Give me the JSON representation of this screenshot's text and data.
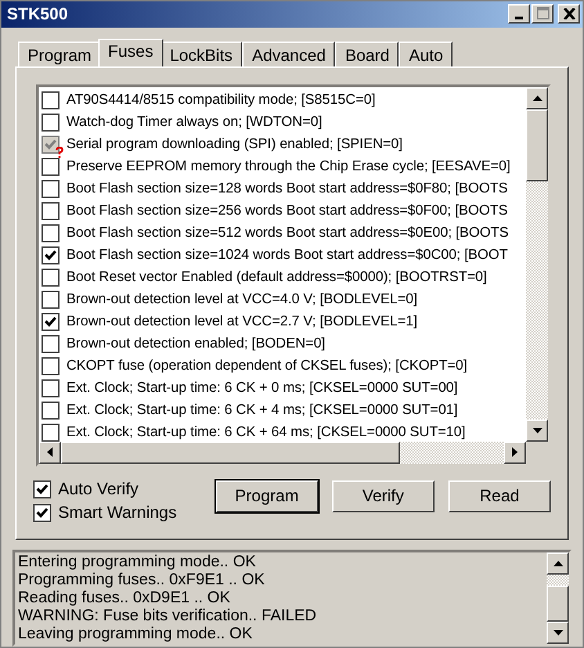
{
  "window": {
    "title": "STK500"
  },
  "tabs": [
    {
      "label": "Program",
      "selected": false
    },
    {
      "label": "Fuses",
      "selected": true
    },
    {
      "label": "LockBits",
      "selected": false
    },
    {
      "label": "Advanced",
      "selected": false
    },
    {
      "label": "Board",
      "selected": false
    },
    {
      "label": "Auto",
      "selected": false
    }
  ],
  "fuses": [
    {
      "label": "AT90S4414/8515 compatibility mode; [S8515C=0]",
      "checked": false,
      "disabled": false
    },
    {
      "label": "Watch-dog Timer always on; [WDTON=0]",
      "checked": false,
      "disabled": false
    },
    {
      "label": "Serial program downloading (SPI) enabled; [SPIEN=0]",
      "checked": true,
      "disabled": true
    },
    {
      "label": "Preserve EEPROM memory through the Chip Erase cycle; [EESAVE=0]",
      "checked": false,
      "disabled": false
    },
    {
      "label": "Boot Flash section size=128 words Boot start address=$0F80; [BOOTS",
      "checked": false,
      "disabled": false
    },
    {
      "label": "Boot Flash section size=256 words Boot start address=$0F00; [BOOTS",
      "checked": false,
      "disabled": false
    },
    {
      "label": "Boot Flash section size=512 words Boot start address=$0E00; [BOOTS",
      "checked": false,
      "disabled": false
    },
    {
      "label": "Boot Flash section size=1024 words Boot start address=$0C00; [BOOT",
      "checked": true,
      "disabled": false
    },
    {
      "label": "Boot Reset vector Enabled (default address=$0000); [BOOTRST=0]",
      "checked": false,
      "disabled": false
    },
    {
      "label": "Brown-out detection level at VCC=4.0 V; [BODLEVEL=0]",
      "checked": false,
      "disabled": false
    },
    {
      "label": "Brown-out detection level at VCC=2.7 V; [BODLEVEL=1]",
      "checked": true,
      "disabled": false
    },
    {
      "label": "Brown-out detection enabled; [BODEN=0]",
      "checked": false,
      "disabled": false
    },
    {
      "label": "CKOPT fuse (operation dependent of CKSEL fuses); [CKOPT=0]",
      "checked": false,
      "disabled": false
    },
    {
      "label": "Ext. Clock; Start-up time: 6 CK + 0 ms; [CKSEL=0000 SUT=00]",
      "checked": false,
      "disabled": false
    },
    {
      "label": "Ext. Clock; Start-up time: 6 CK + 4 ms; [CKSEL=0000 SUT=01]",
      "checked": false,
      "disabled": false
    },
    {
      "label": "Ext. Clock; Start-up time: 6 CK + 64 ms; [CKSEL=0000 SUT=10]",
      "checked": false,
      "disabled": false
    }
  ],
  "options": [
    {
      "label": "Auto Verify",
      "checked": true
    },
    {
      "label": "Smart Warnings",
      "checked": true
    }
  ],
  "buttons": [
    {
      "label": "Program",
      "selected": true
    },
    {
      "label": "Verify",
      "selected": false
    },
    {
      "label": "Read",
      "selected": false
    }
  ],
  "log": [
    "Entering programming mode.. OK",
    "Programming fuses.. 0xF9E1 .. OK",
    "Reading fuses.. 0xD9E1 .. OK",
    "WARNING: Fuse bits verification..  FAILED",
    "Leaving programming mode.. OK"
  ]
}
